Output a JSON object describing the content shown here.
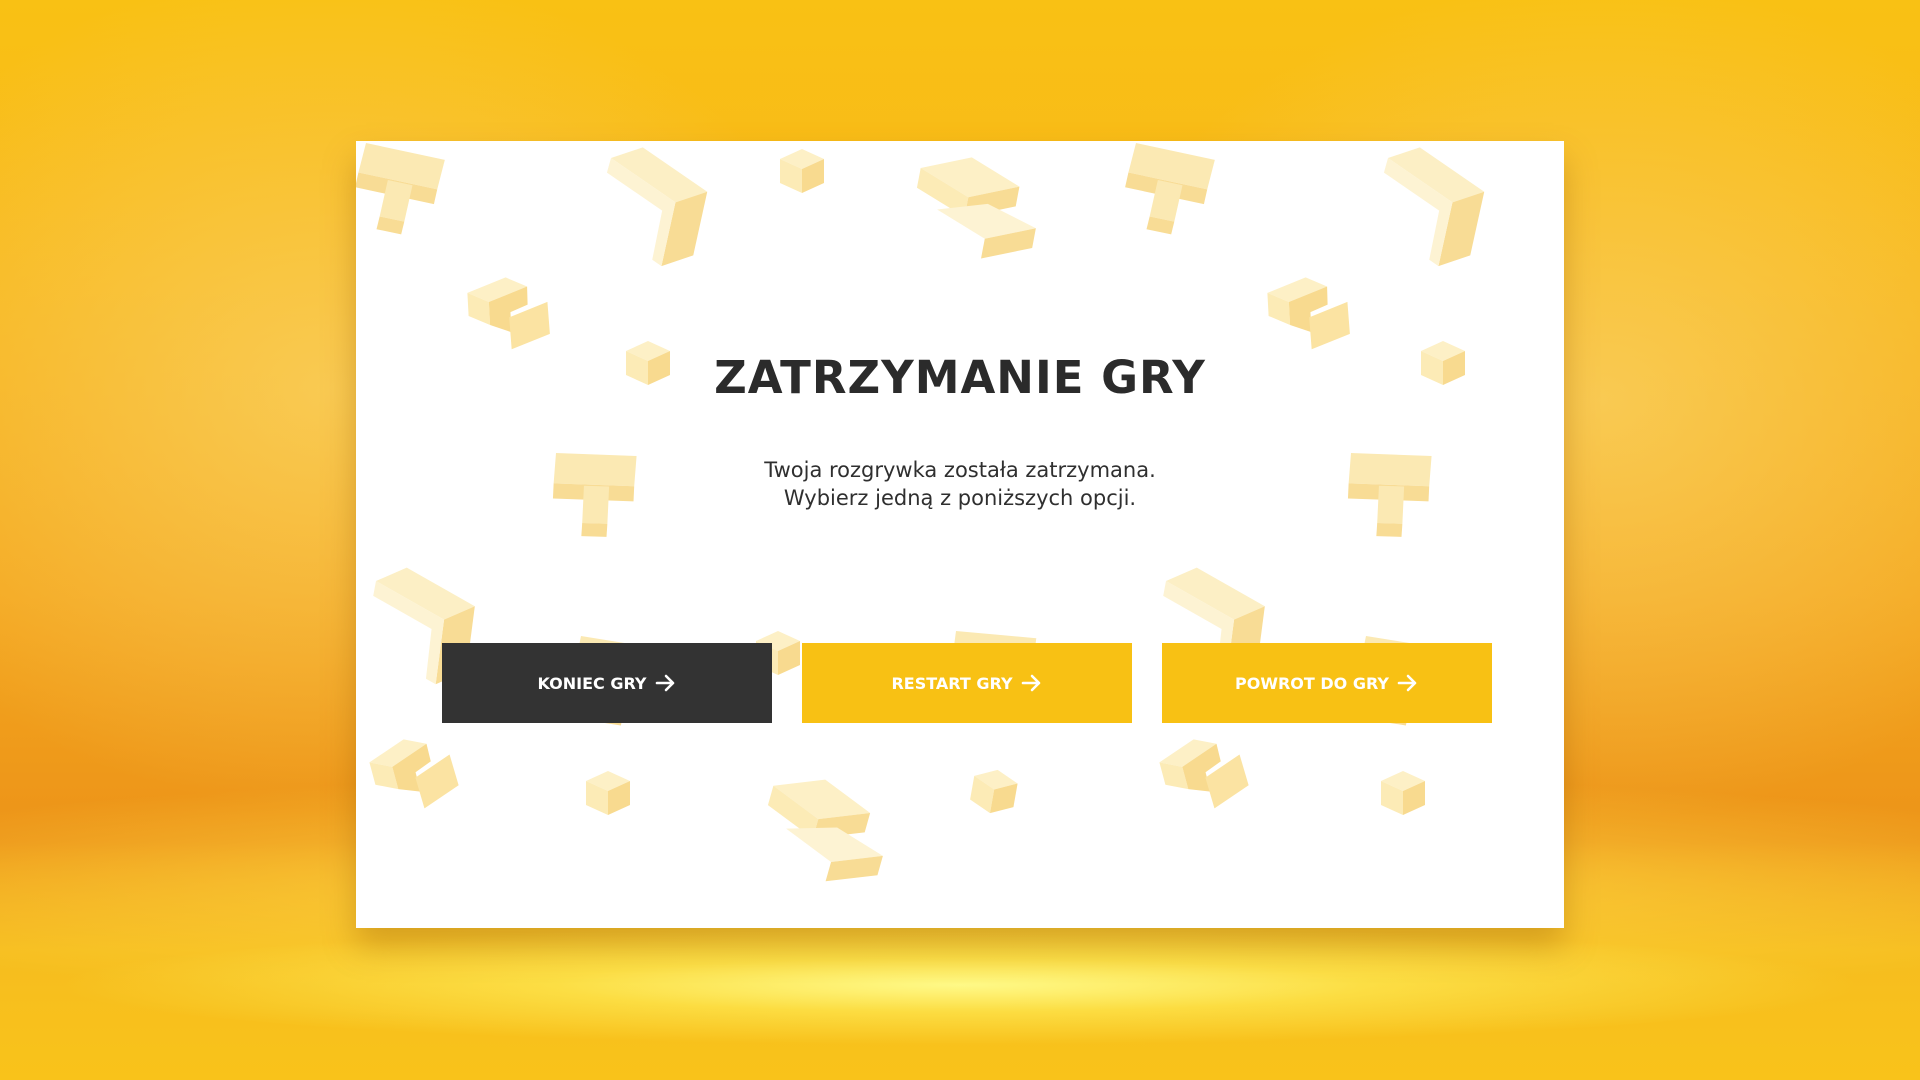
{
  "pause_dialog": {
    "title": "ZATRZYMANIE GRY",
    "message_line1": "Twoja rozgrywka została zatrzymana.",
    "message_line2": "Wybierz jedną z poniższych opcji.",
    "buttons": [
      {
        "label": "KONIEC GRY",
        "icon": "arrow-right-icon",
        "color": "#333333"
      },
      {
        "label": "RESTART GRY",
        "icon": "arrow-right-icon",
        "color": "#f8c114"
      },
      {
        "label": "POWROT DO GRY",
        "icon": "arrow-right-icon",
        "color": "#f8c114"
      }
    ]
  },
  "theme": {
    "background": "#f8b81b",
    "dialog_background": "#ffffff",
    "pattern_color": "#fbe7a8",
    "text_color": "#2b2b2b"
  }
}
